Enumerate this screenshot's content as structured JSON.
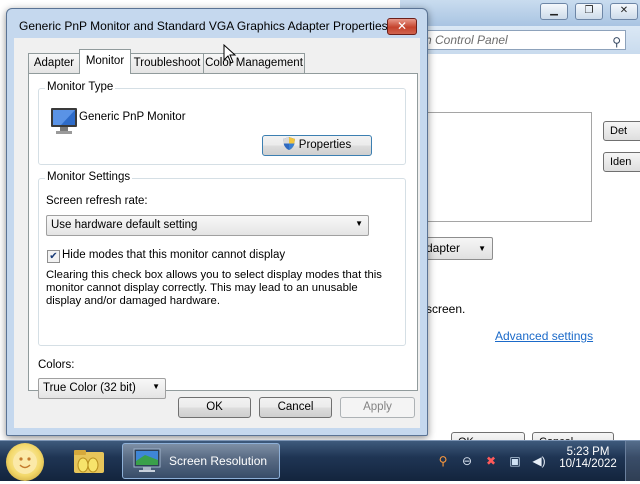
{
  "background_window": {
    "search_placeholder": "rch Control Panel",
    "buttons": {
      "detect": "Det",
      "identify": "Iden",
      "ok": "OK",
      "cancel": "Cancel"
    },
    "adapter_select_value": "dapter",
    "screen_text": "screen.",
    "advanced_link": "Advanced settings"
  },
  "dialog": {
    "title": "Generic PnP Monitor and Standard VGA Graphics Adapter Properties",
    "close_label": "✕",
    "tabs": [
      {
        "label": "Adapter"
      },
      {
        "label": "Monitor"
      },
      {
        "label": "Troubleshoot"
      },
      {
        "label": "Color Management"
      }
    ],
    "monitor_type": {
      "group_label": "Monitor Type",
      "monitor_name": "Generic PnP Monitor",
      "properties_button": "Properties"
    },
    "monitor_settings": {
      "group_label": "Monitor Settings",
      "refresh_label": "Screen refresh rate:",
      "refresh_value": "Use hardware default setting",
      "hide_modes_label": "Hide modes that this monitor cannot display",
      "hide_modes_checked": true,
      "description": "Clearing this check box allows you to select display modes that this monitor cannot display correctly. This may lead to an unusable display and/or damaged hardware."
    },
    "colors": {
      "label": "Colors:",
      "value": "True Color (32 bit)"
    },
    "buttons": {
      "ok": "OK",
      "cancel": "Cancel",
      "apply": "Apply"
    }
  },
  "taskbar": {
    "task_label": "Screen Resolution",
    "time": "5:23 PM",
    "date": "10/14/2022"
  },
  "colors": {
    "accent_link": "#1b6ac9",
    "close_button": "#c5432d"
  }
}
